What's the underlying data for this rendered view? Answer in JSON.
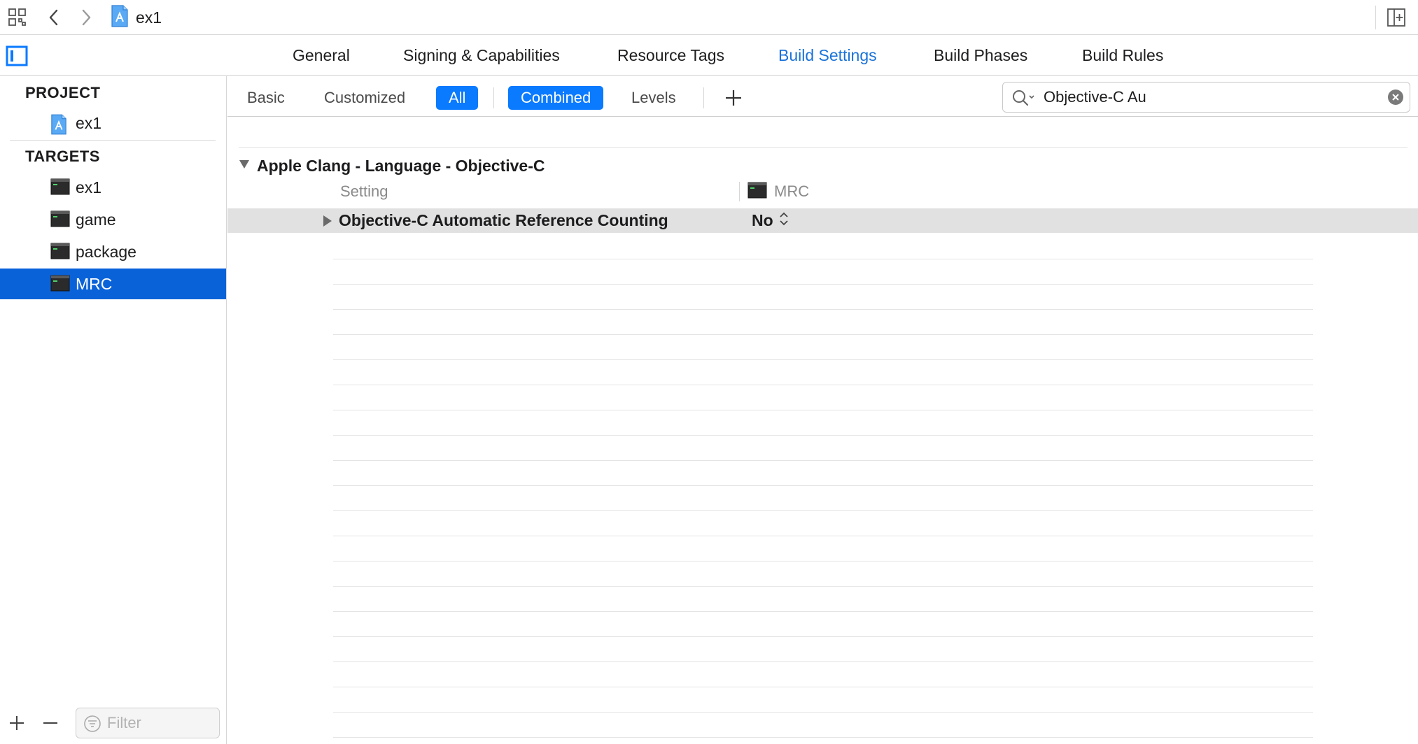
{
  "jumpbar": {
    "file_label": "ex1",
    "icons": [
      "grid-icon",
      "back-chevron-icon",
      "forward-chevron-icon",
      "project-file-icon",
      "add-editor-icon"
    ]
  },
  "tabs": [
    {
      "label": "General",
      "active": false
    },
    {
      "label": "Signing & Capabilities",
      "active": false
    },
    {
      "label": "Resource Tags",
      "active": false
    },
    {
      "label": "Build Settings",
      "active": true
    },
    {
      "label": "Build Phases",
      "active": false
    },
    {
      "label": "Build Rules",
      "active": false
    }
  ],
  "navigator": {
    "project_header": "PROJECT",
    "project_item": "ex1",
    "targets_header": "TARGETS",
    "targets": [
      {
        "label": "ex1",
        "selected": false
      },
      {
        "label": "game",
        "selected": false
      },
      {
        "label": "package",
        "selected": false
      },
      {
        "label": "MRC",
        "selected": true
      }
    ],
    "filter_placeholder": "Filter"
  },
  "toolbar": {
    "basic": "Basic",
    "customized": "Customized",
    "all": "All",
    "combined": "Combined",
    "levels": "Levels",
    "search_value": "Objective-C Au"
  },
  "settings": {
    "group_title": "Apple Clang - Language - Objective-C",
    "column_setting": "Setting",
    "column_target": "MRC",
    "rows": [
      {
        "name": "Objective-C Automatic Reference Counting",
        "value": "No"
      }
    ]
  },
  "colors": {
    "accent": "#0a7aff",
    "selection": "#0a62d9",
    "active_tab": "#1a73d9",
    "row_highlight": "#e1e1e1"
  }
}
